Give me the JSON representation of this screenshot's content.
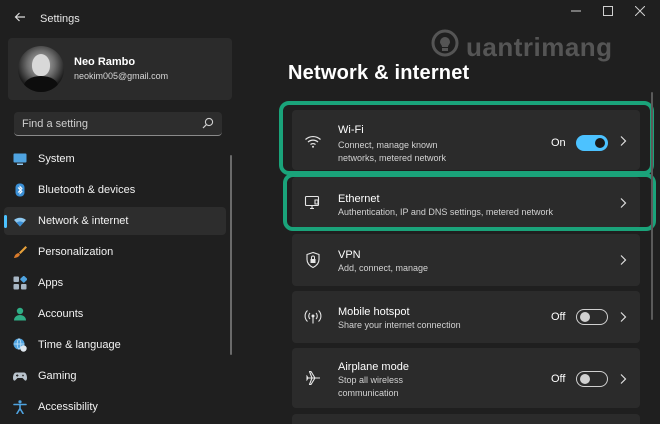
{
  "window": {
    "title": "Settings"
  },
  "user": {
    "name": "Neo Rambo",
    "email": "neokim005@gmail.com"
  },
  "search": {
    "placeholder": "Find a setting"
  },
  "sidebar": {
    "items": [
      {
        "label": "System",
        "icon": "monitor-icon",
        "active": false
      },
      {
        "label": "Bluetooth & devices",
        "icon": "bluetooth-icon",
        "active": false
      },
      {
        "label": "Network & internet",
        "icon": "wifi-icon",
        "active": true
      },
      {
        "label": "Personalization",
        "icon": "brush-icon",
        "active": false
      },
      {
        "label": "Apps",
        "icon": "apps-icon",
        "active": false
      },
      {
        "label": "Accounts",
        "icon": "person-icon",
        "active": false
      },
      {
        "label": "Time & language",
        "icon": "globe-clock-icon",
        "active": false
      },
      {
        "label": "Gaming",
        "icon": "gamepad-icon",
        "active": false
      },
      {
        "label": "Accessibility",
        "icon": "accessibility-icon",
        "active": false
      }
    ]
  },
  "main": {
    "title": "Network & internet",
    "cards": [
      {
        "title": "Wi-Fi",
        "description": "Connect, manage known networks, metered network",
        "state": "On",
        "toggle_on": true,
        "icon": "wifi-icon"
      },
      {
        "title": "Ethernet",
        "description": "Authentication, IP and DNS settings, metered network",
        "icon": "ethernet-icon"
      },
      {
        "title": "VPN",
        "description": "Add, connect, manage",
        "icon": "shield-icon"
      },
      {
        "title": "Mobile hotspot",
        "description": "Share your internet connection",
        "state": "Off",
        "toggle_on": false,
        "icon": "hotspot-icon"
      },
      {
        "title": "Airplane mode",
        "description": "Stop all wireless communication",
        "state": "Off",
        "toggle_on": false,
        "icon": "airplane-icon"
      }
    ]
  },
  "watermark": {
    "text": "uantrimang"
  },
  "colors": {
    "accent": "#4cc2ff",
    "highlight": "#1aa37a",
    "card": "#2b2b2b",
    "background": "#1f1f1f"
  }
}
